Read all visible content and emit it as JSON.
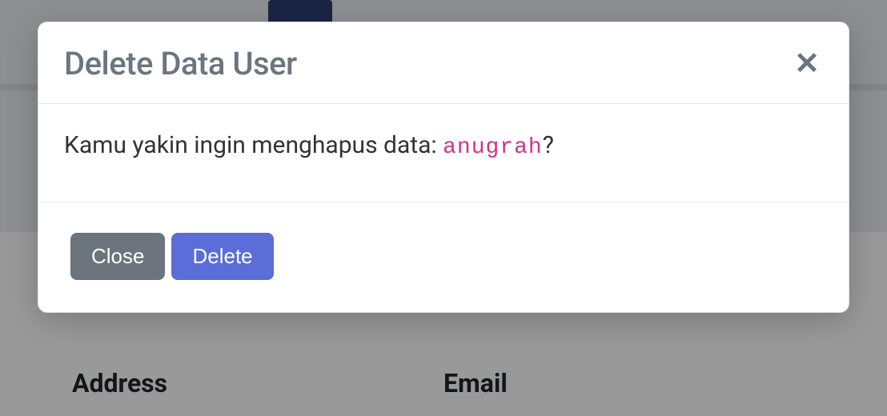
{
  "modal": {
    "title": "Delete Data User",
    "body_prefix": "Kamu yakin ingin menghapus data: ",
    "body_value": "anugrah",
    "body_suffix": "?",
    "close_label": "Close",
    "delete_label": "Delete"
  },
  "background": {
    "columns": {
      "address": "Address",
      "email": "Email"
    }
  }
}
